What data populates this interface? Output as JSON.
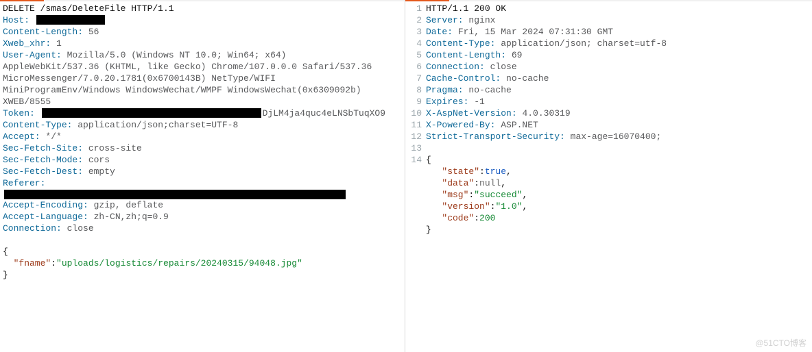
{
  "request": {
    "line1": "DELETE /smas/DeleteFile HTTP/1.1",
    "host_label": "Host: ",
    "content_length_k": "Content-Length: ",
    "content_length_v": "56",
    "xweb_k": "Xweb_xhr: ",
    "xweb_v": "1",
    "ua_k": "User-Agent: ",
    "ua_v1": "Mozilla/5.0 (Windows NT 10.0; Win64; x64)",
    "ua_cont1": "AppleWebKit/537.36 (KHTML, like Gecko) Chrome/107.0.0.0 Safari/537.36",
    "ua_cont2": "MicroMessenger/7.0.20.1781(0x6700143B) NetType/WIFI",
    "ua_cont3": "MiniProgramEnv/Windows WindowsWechat/WMPF WindowsWechat(0x6309092b)",
    "ua_cont4": "XWEB/8555",
    "token_k": "Token: ",
    "token_suffix": "DjLM4ja4quc4eLNSbTuqXO9",
    "ctype_k": "Content-Type: ",
    "ctype_v": "application/json;charset=UTF-8",
    "accept_k": "Accept: ",
    "accept_v": "*/*",
    "sfsite_k": "Sec-Fetch-Site: ",
    "sfsite_v": "cross-site",
    "sfmode_k": "Sec-Fetch-Mode: ",
    "sfmode_v": "cors",
    "sfdest_k": "Sec-Fetch-Dest: ",
    "sfdest_v": "empty",
    "referer_k": "Referer:",
    "aenc_k": "Accept-Encoding: ",
    "aenc_v": "gzip, deflate",
    "alang_k": "Accept-Language: ",
    "alang_v": "zh-CN,zh;q=0.9",
    "conn_k": "Connection: ",
    "conn_v": "close",
    "body_open": "{",
    "body_key": "  \"fname\"",
    "body_val": "\"uploads/logistics/repairs/20240315/94048.jpg\"",
    "body_close": "}"
  },
  "response": {
    "status": "HTTP/1.1 200 OK",
    "server_k": "Server: ",
    "server_v": "nginx",
    "date_k": "Date: ",
    "date_v": "Fri, 15 Mar 2024 07:31:30 GMT",
    "ctype_k": "Content-Type: ",
    "ctype_v": "application/json; charset=utf-8",
    "clen_k": "Content-Length: ",
    "clen_v": "69",
    "conn_k": "Connection: ",
    "conn_v": "close",
    "cc_k": "Cache-Control: ",
    "cc_v": "no-cache",
    "pragma_k": "Pragma: ",
    "pragma_v": "no-cache",
    "exp_k": "Expires: ",
    "exp_v": "-1",
    "xasp_k": "X-AspNet-Version: ",
    "xasp_v": "4.0.30319",
    "xpow_k": "X-Powered-By: ",
    "xpow_v": "ASP.NET",
    "sts_k": "Strict-Transport-Security: ",
    "sts_v": "max-age=16070400;",
    "body_open": "{",
    "state_k": "   \"state\"",
    "state_v": "true",
    "data_k": "   \"data\"",
    "data_v": "null",
    "msg_k": "   \"msg\"",
    "msg_v": "\"succeed\"",
    "ver_k": "   \"version\"",
    "ver_v": "\"1.0\"",
    "code_k": "   \"code\"",
    "code_v": "200",
    "body_close": "}"
  },
  "gutter": {
    "1": "1",
    "2": "2",
    "3": "3",
    "4": "4",
    "5": "5",
    "6": "6",
    "7": "7",
    "8": "8",
    "9": "9",
    "10": "10",
    "11": "11",
    "12": "12",
    "13": "13",
    "14": "14"
  },
  "watermark": "@51CTO博客"
}
